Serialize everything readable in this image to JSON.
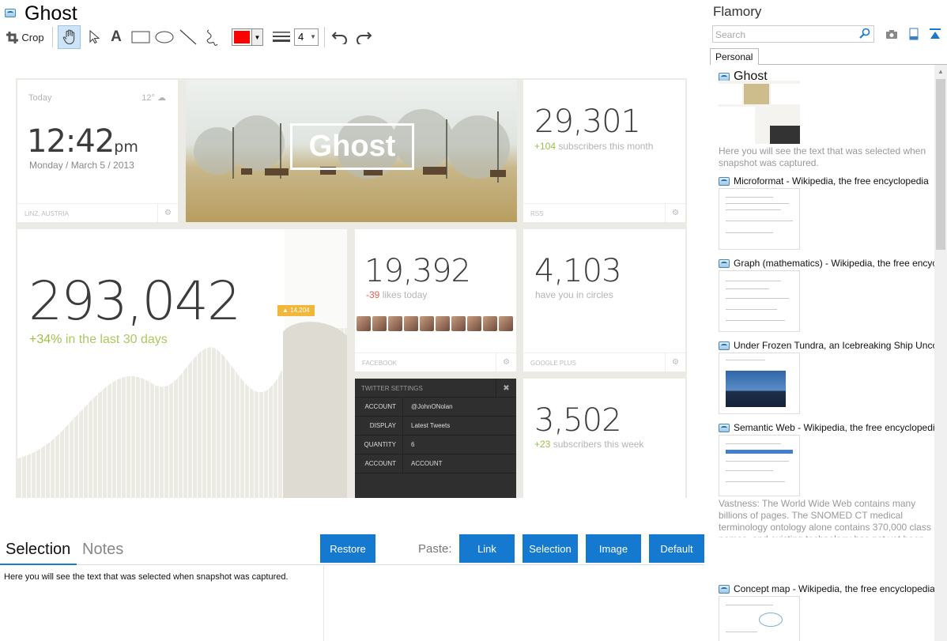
{
  "document": {
    "title": "Ghost"
  },
  "toolbar": {
    "crop_label": "Crop",
    "color": "#ff0000",
    "line_width": "4",
    "tools": [
      "hand-icon",
      "pointer-icon",
      "text-icon",
      "rectangle-icon",
      "ellipse-icon",
      "line-icon",
      "freehand-icon",
      "line-width-icon",
      "undo-icon",
      "redo-icon"
    ]
  },
  "snapshot": {
    "weather": {
      "label": "Today",
      "temp": "12°",
      "time": "12:42",
      "ampm": "pm",
      "date": "Monday / March 5 / 2013",
      "location": "LINZ, AUSTRIA"
    },
    "hero": {
      "logo_text": "Ghost"
    },
    "rss": {
      "number": "29,301",
      "delta": "+104",
      "caption": "subscribers this month",
      "label": "RSS"
    },
    "main_stat": {
      "number": "293,042",
      "delta": "+34%",
      "caption": "in the last 30 days",
      "marker": "14,204"
    },
    "facebook": {
      "number": "19,392",
      "delta": "-39",
      "caption": "likes today",
      "label": "FACEBOOK"
    },
    "google": {
      "number": "4,103",
      "caption": "have you in circles",
      "label": "GOOGLE PLUS"
    },
    "twitter": {
      "header": "TWITTER SETTINGS",
      "rows": [
        {
          "key": "ACCOUNT",
          "value": "@JohnONolan"
        },
        {
          "key": "DISPLAY",
          "value": "Latest Tweets"
        },
        {
          "key": "QUANTITY",
          "value": "6"
        },
        {
          "key": "ACCOUNT",
          "value": "ACCOUNT"
        }
      ]
    },
    "week": {
      "number": "3,502",
      "delta": "+23",
      "caption": "subscribers this week"
    }
  },
  "bottom": {
    "tabs": {
      "selection": "Selection",
      "notes": "Notes"
    },
    "restore_label": "Restore",
    "paste_label": "Paste:",
    "buttons": {
      "link": "Link",
      "selection": "Selection",
      "image": "Image",
      "default": "Default"
    },
    "selection_text": "Here you will see the text that was selected when snapshot was captured."
  },
  "panel": {
    "app_name": "Flamory",
    "search_placeholder": "Search",
    "tab": "Personal",
    "items": [
      {
        "title": "Ghost",
        "desc": "Here you will see the text that was selected when snapshot was captured."
      },
      {
        "title": "Microformat - Wikipedia, the free encyclopedia"
      },
      {
        "title": "Graph (mathematics) - Wikipedia, the free encyclopedia"
      },
      {
        "title": "Under Frozen Tundra, an Icebreaking Ship Uncovers Secrets"
      },
      {
        "title": "Semantic Web - Wikipedia, the free encyclopedia",
        "desc": "Vastness: The World Wide Web contains many billions of pages. The SNOMED CT medical terminology ontology alone contains 370,000 class names, and existing technology has not yet been able to eliminate all semantically duplicated terms. Any automated reasoning system will have to deal with truly huge inputs."
      },
      {
        "title": "Concept map - Wikipedia, the free encyclopedia"
      }
    ]
  }
}
